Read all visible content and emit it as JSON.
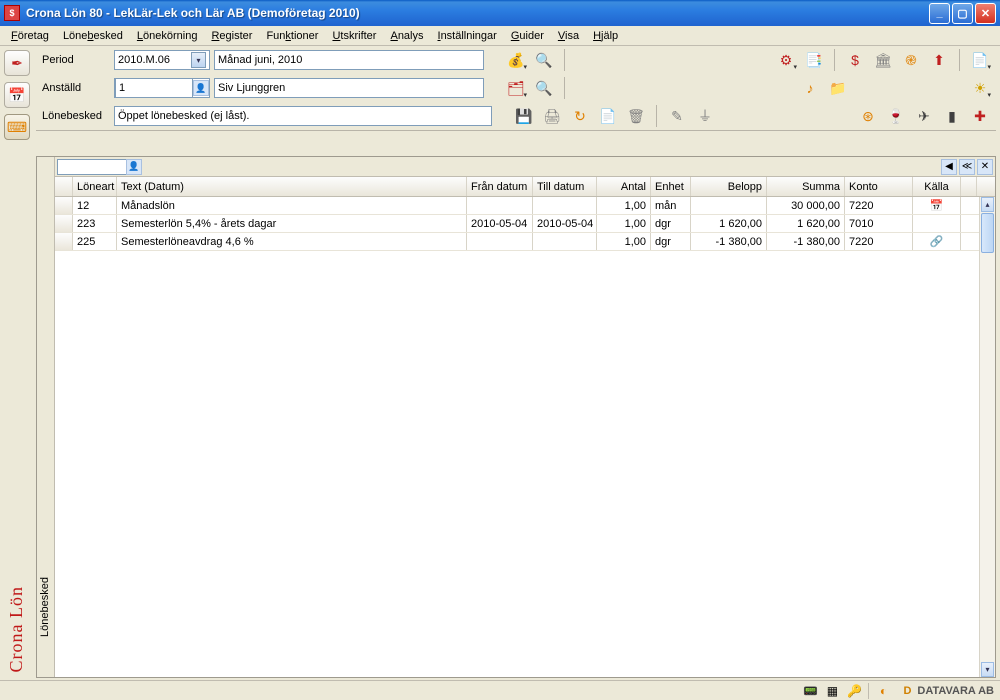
{
  "window": {
    "title": "Crona Lön 80 - LekLär-Lek och  Lär AB (Demoföretag 2010)"
  },
  "menus": [
    "Företag",
    "Lönebesked",
    "Lönekörning",
    "Register",
    "Funktioner",
    "Utskrifter",
    "Analys",
    "Inställningar",
    "Guider",
    "Visa",
    "Hjälp"
  ],
  "period": {
    "label": "Period",
    "value": "2010.M.06",
    "display": "Månad juni, 2010"
  },
  "employee": {
    "label": "Anställd",
    "id": "1",
    "name": "Siv Ljunggren"
  },
  "payslip": {
    "label": "Lönebesked",
    "status": "Öppet lönebesked (ej låst)."
  },
  "grid": {
    "tabLabel": "Lönebesked",
    "columns": {
      "loneart": "Löneart",
      "text": "Text  (Datum)",
      "fran": "Från datum",
      "till": "Till datum",
      "antal": "Antal",
      "enhet": "Enhet",
      "belopp": "Belopp",
      "summa": "Summa",
      "konto": "Konto",
      "kalla": "Källa"
    },
    "rows": [
      {
        "loneart": "12",
        "text": "Månadslön",
        "fran": "",
        "till": "",
        "antal": "1,00",
        "enhet": "mån",
        "belopp": "",
        "summa": "30 000,00",
        "konto": "7220",
        "kalla": "calendar"
      },
      {
        "loneart": "223",
        "text": "Semesterlön 5,4% - årets dagar",
        "fran": "2010-05-04",
        "till": "2010-05-04",
        "antal": "1,00",
        "enhet": "dgr",
        "belopp": "1 620,00",
        "summa": "1 620,00",
        "konto": "7010",
        "kalla": ""
      },
      {
        "loneart": "225",
        "text": "Semesterlöneavdrag 4,6 %",
        "fran": "",
        "till": "",
        "antal": "1,00",
        "enhet": "dgr",
        "belopp": "-1 380,00",
        "summa": "-1 380,00",
        "konto": "7220",
        "kalla": "link"
      }
    ]
  },
  "brand": {
    "side": "Crona Lön",
    "vendor": "DATAVARA AB"
  }
}
